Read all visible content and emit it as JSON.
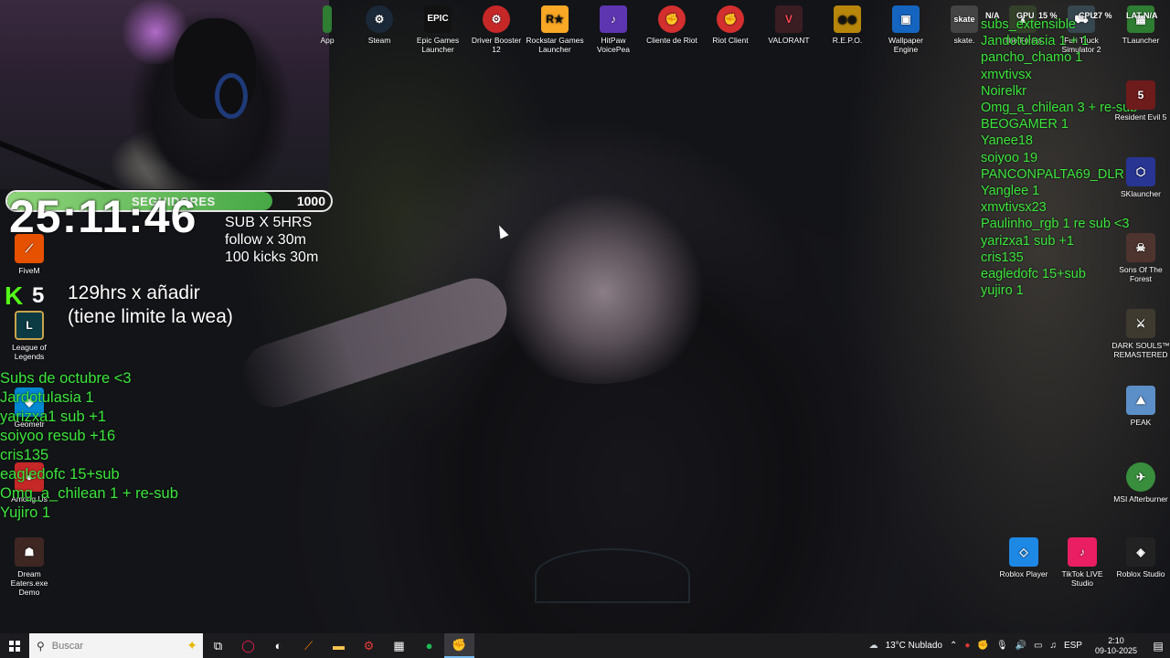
{
  "webcam_overlay": {
    "timer": "25:11:46",
    "bar_label": "SEGUIDORES",
    "bar_value": "1000",
    "bar_progress_pct": 82,
    "rules": [
      "SUB X 5HRS",
      "follow x 30m",
      "100 kicks 30m"
    ],
    "kick_count": "5",
    "cap_note_line1": "129hrs  x añadir",
    "cap_note_line2": "(tiene limite la wea)"
  },
  "subs_list": {
    "title": "Subs de octubre <3",
    "items": [
      "Jardotulasia 1",
      "yarizxa1 sub +1",
      "soiyoo resub +16",
      "cris135",
      "eagledofc 15+sub",
      "Omg_a_chilean 1 + re-sub",
      "Yujiro 1"
    ]
  },
  "chat_list": {
    "items": [
      "subs_extensible",
      "Jandotulasia 1 + 1",
      "pancho_chamo 1",
      "xmvtivsx",
      "Noirelkr",
      "Omg_a_chilean 3 + re-sub",
      "BEOGAMER 1",
      "Yanee18",
      "soiyoo 19",
      "PANCONPALTA69_DLR 5",
      "Yanglee 1",
      "xmvtivsx23",
      "Paulinho_rgb 1 re sub <3",
      "yarizxa1 sub +1",
      "cris135",
      "eagledofc 15+sub",
      "yujiro 1"
    ]
  },
  "stats": {
    "gpu_label": "GPU",
    "gpu_value": "15 %",
    "cpu_label": "CPU",
    "cpu_value": "27 %",
    "na1": "N/A",
    "lat_label": "LAT",
    "na2": "N/A"
  },
  "desktop_top_icons": [
    {
      "label": "App",
      "icon": "app-icon",
      "color": "#2e7d32"
    },
    {
      "label": "Steam",
      "icon": "steam-icon",
      "color": "#1b2838"
    },
    {
      "label": "Epic Games Launcher",
      "icon": "epic-games-icon",
      "color": "#121212"
    },
    {
      "label": "Driver Booster 12",
      "icon": "driver-booster-icon",
      "color": "#c62828"
    },
    {
      "label": "Rockstar Games Launcher",
      "icon": "rockstar-icon",
      "color": "#f9a825"
    },
    {
      "label": "HitPaw VoicePea",
      "icon": "hitpaw-icon",
      "color": "#5e35b1"
    },
    {
      "label": "Cliente de Riot",
      "icon": "riot-client-icon",
      "color": "#d32f2f"
    },
    {
      "label": "Riot Client",
      "icon": "riot-client-icon",
      "color": "#d32f2f"
    },
    {
      "label": "VALORANT",
      "icon": "valorant-icon",
      "color": "#3a1d22"
    },
    {
      "label": "R.E.P.O.",
      "icon": "repo-icon",
      "color": "#b8860b"
    },
    {
      "label": "Wallpaper Engine",
      "icon": "wallpaper-engine-icon",
      "color": "#1565c0"
    },
    {
      "label": "skate.",
      "icon": "skate-icon",
      "color": "#444"
    },
    {
      "label": "The Forest",
      "icon": "the-forest-icon",
      "color": "#33402a"
    },
    {
      "label": "Furi Truck Simulator 2",
      "icon": "truck-sim-icon",
      "color": "#37474f"
    },
    {
      "label": "TLauncher",
      "icon": "tlauncher-icon",
      "color": "#2e7d32"
    }
  ],
  "desktop_left_icons": [
    {
      "label": "FiveM",
      "icon": "fivem-icon",
      "color": "#e65100"
    },
    {
      "label": "League of Legends",
      "icon": "lol-icon",
      "color": "#0d3b44"
    },
    {
      "label": "Geometr",
      "icon": "geometry-dash-icon",
      "color": "#0288d1"
    },
    {
      "label": "Among Us",
      "icon": "among-us-icon",
      "color": "#c62828"
    },
    {
      "label": "Dream Eaters.exe Demo",
      "icon": "dream-eaters-icon",
      "color": "#3e2723"
    }
  ],
  "desktop_right_icons": [
    {
      "label": "Resident Evil 5",
      "icon": "resident-evil-icon",
      "color": "#6d1b1b"
    },
    {
      "label": "SKlauncher",
      "icon": "sklauncher-icon",
      "color": "#283593"
    },
    {
      "label": "Sons Of The Forest",
      "icon": "sons-forest-icon",
      "color": "#4e342e"
    },
    {
      "label": "DARK SOULS™ REMASTERED",
      "icon": "dark-souls-icon",
      "color": "#3e3a30"
    },
    {
      "label": "PEAK",
      "icon": "peak-icon",
      "color": "#5c8fc7"
    },
    {
      "label": "MSI Afterburner",
      "icon": "msi-afterburner-icon",
      "color": "#388e3c"
    }
  ],
  "desktop_bottom_right_icons": [
    {
      "label": "Roblox Player",
      "icon": "roblox-player-icon",
      "color": "#1e88e5"
    },
    {
      "label": "TikTok LIVE Studio",
      "icon": "tiktok-live-icon",
      "color": "#e91e63"
    },
    {
      "label": "Roblox Studio",
      "icon": "roblox-studio-icon",
      "color": "#222"
    }
  ],
  "taskbar": {
    "search_placeholder": "Buscar",
    "weather": "13°C  Nublado",
    "lang": "ESP",
    "time": "2:10",
    "date": "09-10-2025"
  }
}
